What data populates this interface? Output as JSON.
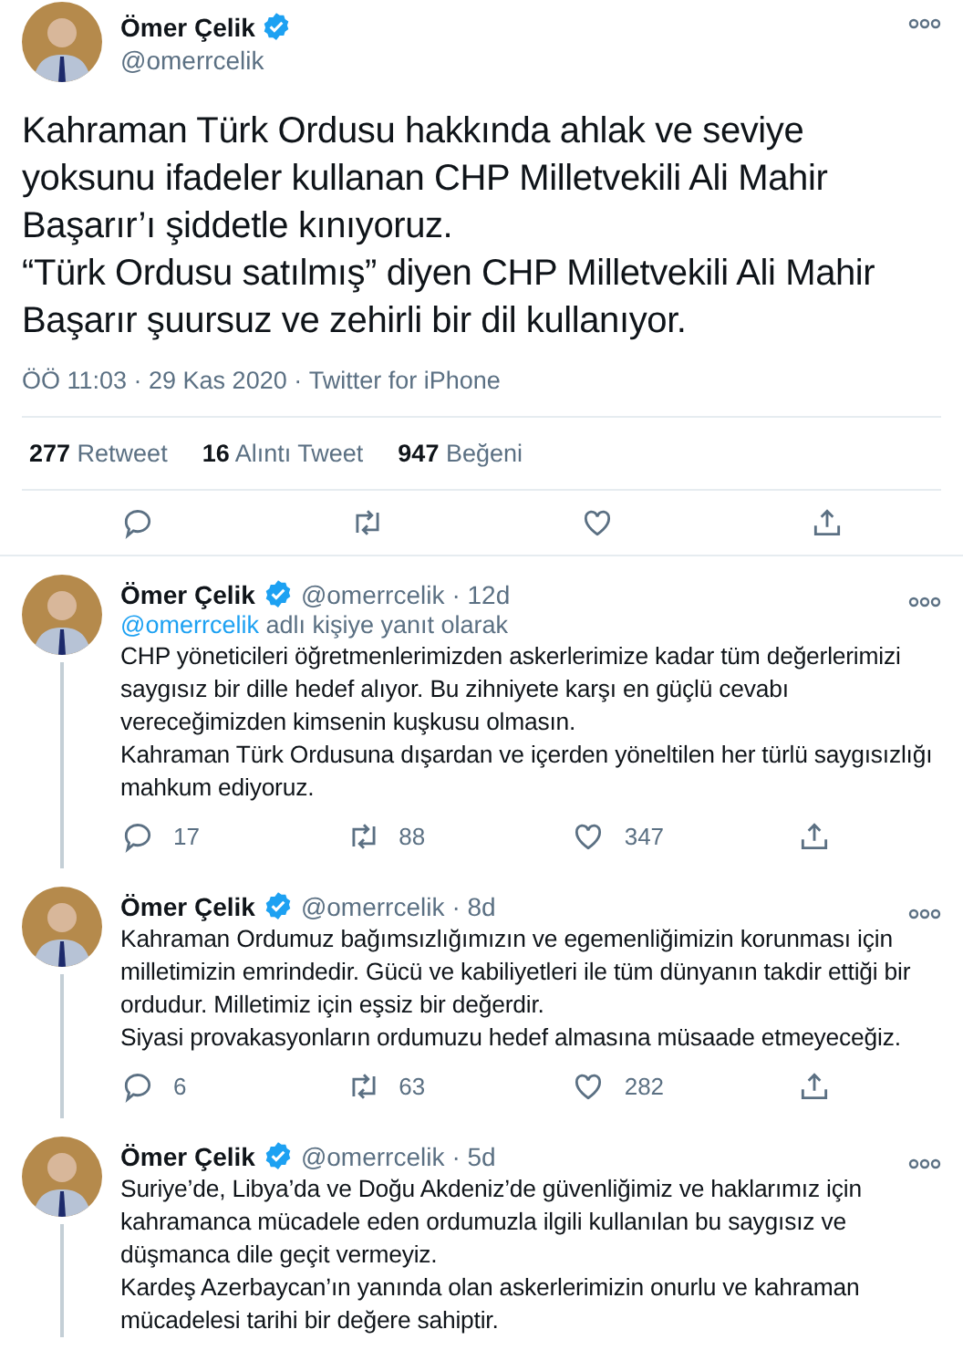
{
  "main_tweet": {
    "name": "Ömer Çelik",
    "handle": "@omerrcelik",
    "verified": true,
    "text": "Kahraman Türk Ordusu hakkında ahlak ve seviye yoksunu ifadeler kullanan CHP Milletvekili Ali Mahir Başarır’ı şiddetle kınıyoruz.\n“Türk Ordusu satılmış” diyen CHP Milletvekili Ali Mahir Başarır şuursuz ve zehirli bir dil kullanıyor.",
    "time": "ÖÖ 11:03 · 29 Kas 2020",
    "separator": " · ",
    "source": "Twitter for iPhone",
    "stats": [
      {
        "count": "277",
        "label": "Retweet"
      },
      {
        "count": "16",
        "label": "Alıntı Tweet"
      },
      {
        "count": "947",
        "label": "Beğeni"
      }
    ]
  },
  "replies": [
    {
      "name": "Ömer Çelik",
      "handle": "@omerrcelik",
      "age": "· 12d",
      "verified": true,
      "reply_to": {
        "mention": "@omerrcelik",
        "text": " adlı kişiye yanıt olarak"
      },
      "text": "CHP yöneticileri öğretmenlerimizden askerlerimize kadar tüm değerlerimizi saygısız bir dille hedef alıyor. Bu zihniyete karşı en güçlü cevabı vereceğimizden kimsenin kuşkusu olmasın.\nKahraman Türk Ordusuna dışardan ve içerden yöneltilen her türlü saygısızlığı mahkum ediyoruz.",
      "counts": {
        "reply": "17",
        "retweet": "88",
        "like": "347"
      }
    },
    {
      "name": "Ömer Çelik",
      "handle": "@omerrcelik",
      "age": "· 8d",
      "verified": true,
      "text": "Kahraman Ordumuz bağımsızlığımızın ve egemenliğimizin korunması için milletimizin emrindedir. Gücü ve kabiliyetleri ile tüm dünyanın takdir ettiği bir ordudur. Milletimiz için eşsiz bir değerdir.\nSiyasi provakasyonların ordumuzu hedef almasına müsaade etmeyeceğiz.",
      "counts": {
        "reply": "6",
        "retweet": "63",
        "like": "282"
      }
    },
    {
      "name": "Ömer Çelik",
      "handle": "@omerrcelik",
      "age": "· 5d",
      "verified": true,
      "text": "Suriye’de, Libya’da ve Doğu Akdeniz’de güvenliğimiz ve haklarımız için kahramanca mücadele eden ordumuzla ilgili kullanılan bu saygısız ve düşmanca dile geçit vermeyiz.\nKardeş Azerbaycan’ın yanında olan askerlerimizin onurlu ve kahraman mücadelesi tarihi bir değere sahiptir."
    }
  ]
}
